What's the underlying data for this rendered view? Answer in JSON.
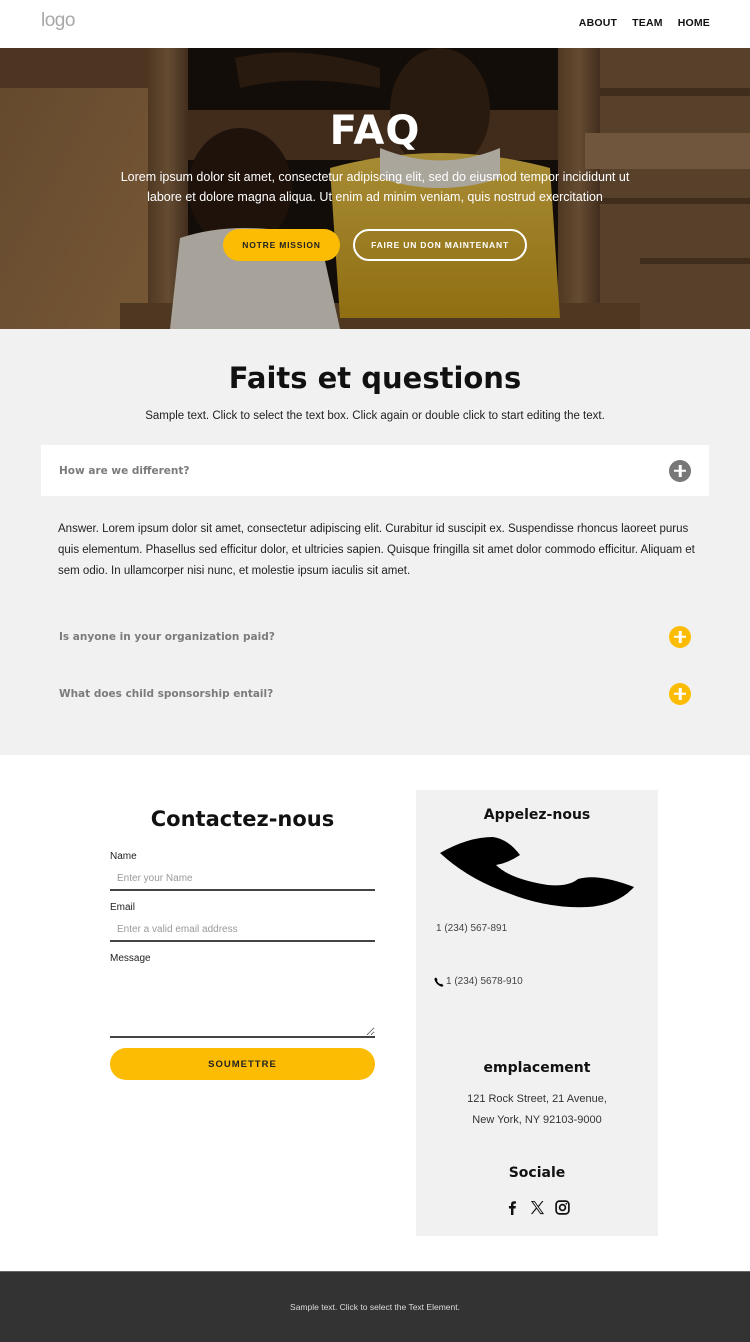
{
  "header": {
    "logo": "logo",
    "nav": [
      {
        "label": "ABOUT"
      },
      {
        "label": "TEAM"
      },
      {
        "label": "HOME"
      }
    ]
  },
  "hero": {
    "title": "FAQ",
    "text": "Lorem ipsum dolor sit amet, consectetur adipiscing elit, sed do eiusmod tempor incididunt ut labore et dolore magna aliqua. Ut enim ad minim veniam, quis nostrud exercitation",
    "primary_button": "NOTRE MISSION",
    "secondary_button": "FAIRE UN DON MAINTENANT"
  },
  "faq": {
    "title": "Faits et questions",
    "subtitle": "Sample text. Click to select the text box. Click again or double click to start editing the text.",
    "items": [
      {
        "question": "How are we different?",
        "expanded": true,
        "answer": "Answer. Lorem ipsum dolor sit amet, consectetur adipiscing elit. Curabitur id suscipit ex. Suspendisse rhoncus laoreet purus quis elementum. Phasellus sed efficitur dolor, et ultricies sapien. Quisque fringilla sit amet dolor commodo efficitur. Aliquam et sem odio. In ullamcorper nisi nunc, et molestie ipsum iaculis sit amet."
      },
      {
        "question": "Is anyone in your organization paid?",
        "expanded": false
      },
      {
        "question": "What does child sponsorship entail?",
        "expanded": false
      }
    ]
  },
  "contact": {
    "title": "Contactez-nous",
    "form": {
      "name_label": "Name",
      "name_placeholder": "Enter your Name",
      "name_value": "",
      "email_label": "Email",
      "email_placeholder": "Enter a valid email address",
      "email_value": "",
      "message_label": "Message",
      "message_value": "",
      "submit": "SOUMETTRE"
    },
    "card": {
      "call_heading": "Appelez-nous",
      "phone_1": "1 (234) 567-891",
      "phone_2": "1 (234) 5678-910",
      "location_heading": "emplacement",
      "address_line_1": "121 Rock Street, 21 Avenue,",
      "address_line_2": "New York, NY 92103-9000",
      "social_heading": "Sociale",
      "socials": [
        "facebook-icon",
        "x-twitter-icon",
        "instagram-icon"
      ]
    }
  },
  "footer": {
    "text": "Sample text. Click to select the Text Element."
  },
  "colors": {
    "accent": "#fcbc04",
    "section_bg": "#f1f1f1",
    "footer_bg": "#333333",
    "question_text": "#7b7b7b"
  }
}
